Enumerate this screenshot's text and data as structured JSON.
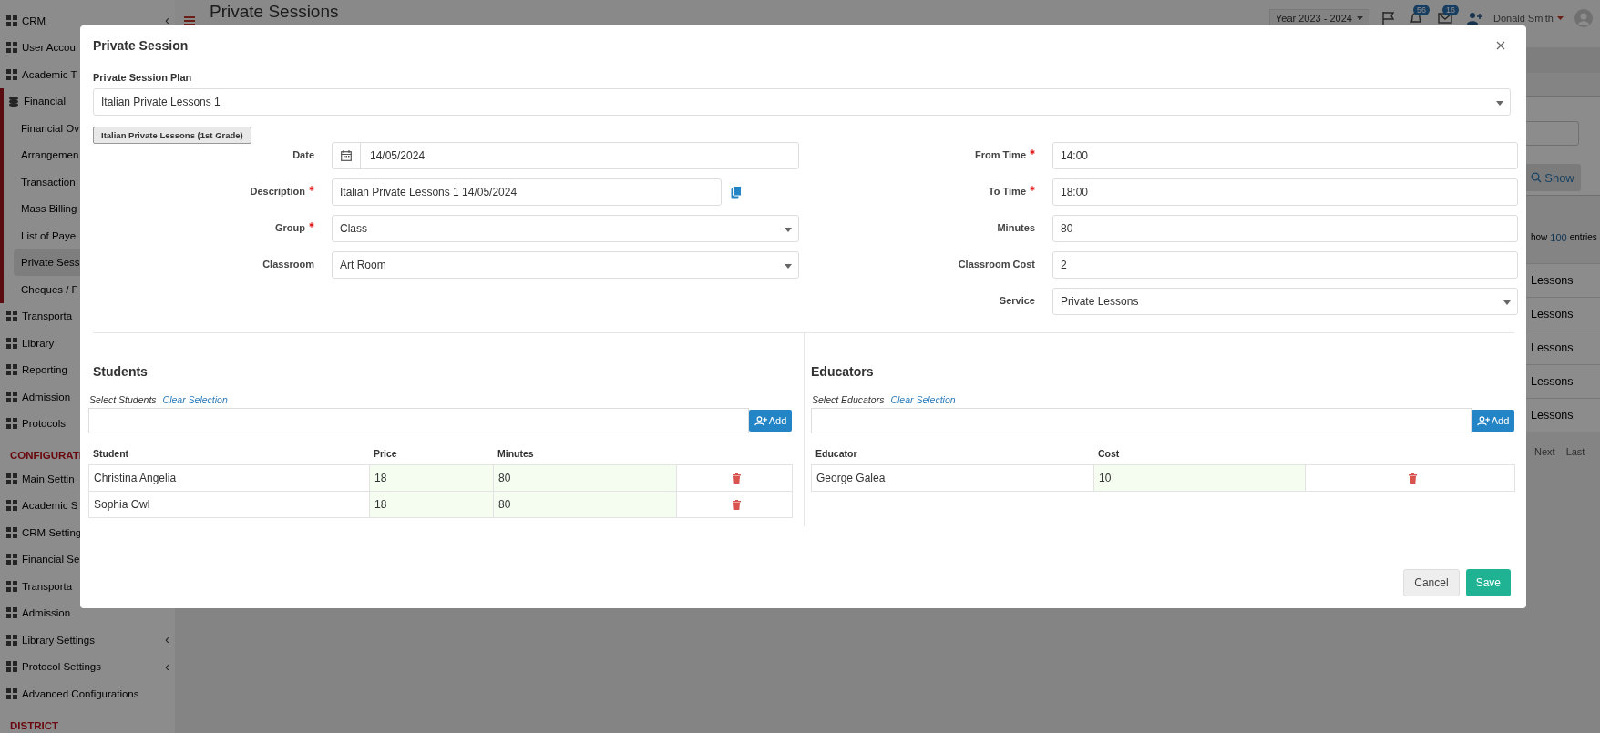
{
  "sidebar": {
    "groups": [
      {
        "items": [
          {
            "label": "CRM",
            "selected": false,
            "caret": "‹"
          },
          {
            "label": "User Accou",
            "selected": false
          },
          {
            "label": "Academic T",
            "selected": false
          },
          {
            "label": "Financial",
            "selected": false,
            "expanded": true,
            "children": [
              {
                "label": "Financial Ov",
                "selected": false
              },
              {
                "label": "Arrangemen",
                "selected": false
              },
              {
                "label": "Transaction",
                "selected": false
              },
              {
                "label": "Mass Billing",
                "selected": false
              },
              {
                "label": "List of Paye",
                "selected": false
              },
              {
                "label": "Private Sess",
                "selected": true
              },
              {
                "label": "Cheques / F",
                "selected": false
              }
            ]
          },
          {
            "label": "Transporta",
            "selected": false
          },
          {
            "label": "Library",
            "selected": false
          },
          {
            "label": "Reporting",
            "selected": false
          },
          {
            "label": "Admission",
            "selected": false
          },
          {
            "label": "Protocols",
            "selected": false
          }
        ]
      },
      {
        "heading": "CONFIGURATI",
        "items": [
          {
            "label": "Main Settin",
            "selected": false
          },
          {
            "label": "Academic S",
            "selected": false
          },
          {
            "label": "CRM Setting",
            "selected": false
          },
          {
            "label": "Financial Se",
            "selected": false
          },
          {
            "label": "Transporta",
            "selected": false
          },
          {
            "label": "Admission",
            "selected": false
          },
          {
            "label": "Library Settings",
            "selected": false,
            "caret": "‹"
          },
          {
            "label": "Protocol Settings",
            "selected": false,
            "caret": "‹"
          },
          {
            "label": "Advanced Configurations",
            "selected": false
          }
        ]
      },
      {
        "heading": "DISTRICT"
      }
    ]
  },
  "top_bar": {
    "title": "Private Sessions",
    "year_select": "Year 2023 - 2024",
    "notifications": [
      {
        "count": "56"
      },
      {
        "count": "16"
      }
    ],
    "user": "Donald Smith"
  },
  "page_background": {
    "show_button": "Show",
    "entries": {
      "prefix": "how",
      "count": "100",
      "suffix": "entries"
    },
    "rows": [
      "Lessons",
      "Lessons",
      "Lessons",
      "Lessons",
      "Lessons"
    ],
    "pager": [
      "Next",
      "Last"
    ]
  },
  "modal": {
    "title": "Private Session",
    "plan": {
      "label": "Private Session Plan",
      "value": "Italian Private Lessons 1"
    },
    "plan_tag": "Italian Private Lessons (1st Grade)",
    "left_fields": [
      {
        "label": "Date",
        "required": false,
        "kind": "date",
        "value": "14/05/2024"
      },
      {
        "label": "Description",
        "required": true,
        "kind": "copy",
        "value": "Italian Private Lessons 1 14/05/2024"
      },
      {
        "label": "Group",
        "required": true,
        "kind": "select",
        "value": "Class"
      },
      {
        "label": "Classroom",
        "required": false,
        "kind": "select",
        "value": "Art Room"
      }
    ],
    "right_fields": [
      {
        "label": "From Time",
        "required": true,
        "kind": "text",
        "value": "14:00"
      },
      {
        "label": "To Time",
        "required": true,
        "kind": "text",
        "value": "18:00"
      },
      {
        "label": "Minutes",
        "required": false,
        "kind": "text",
        "value": "80"
      },
      {
        "label": "Classroom Cost",
        "required": false,
        "kind": "text",
        "value": "2"
      },
      {
        "label": "Service",
        "required": false,
        "kind": "select",
        "value": "Private Lessons"
      }
    ],
    "students": {
      "title": "Students",
      "select_label": "Select Students",
      "clear_link": "Clear Selection",
      "add_button": "Add",
      "columns": [
        "Student",
        "Price",
        "Minutes"
      ],
      "rows": [
        [
          "Christina Angelia",
          "18",
          "80"
        ],
        [
          "Sophia Owl",
          "18",
          "80"
        ]
      ]
    },
    "educators": {
      "title": "Educators",
      "select_label": "Select Educators",
      "clear_link": "Clear Selection",
      "add_button": "Add",
      "columns": [
        "Educator",
        "Cost"
      ],
      "rows": [
        [
          "George Galea",
          "10"
        ]
      ]
    },
    "buttons": {
      "cancel": "Cancel",
      "save": "Save"
    }
  }
}
